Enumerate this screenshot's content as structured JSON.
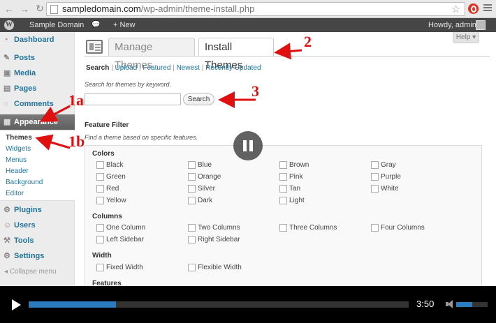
{
  "browser": {
    "url_domain": "sampledomain.com",
    "url_path": "/wp-admin/theme-install.php",
    "back_icon": "back-arrow-icon",
    "forward_icon": "forward-arrow-icon",
    "reload_icon": "reload-icon"
  },
  "adminbar": {
    "site_name": "Sample Domain",
    "new_label": "+ New",
    "greeting": "Howdy, admin"
  },
  "sidebar": {
    "items": [
      {
        "label": "Dashboard",
        "icon": "dashboard-icon"
      },
      {
        "label": "Posts",
        "icon": "pushpin-icon"
      },
      {
        "label": "Media",
        "icon": "media-icon"
      },
      {
        "label": "Pages",
        "icon": "pages-icon"
      },
      {
        "label": "Comments",
        "icon": "comments-icon"
      },
      {
        "label": "Appearance",
        "icon": "appearance-icon"
      },
      {
        "label": "Plugins",
        "icon": "plugin-icon"
      },
      {
        "label": "Users",
        "icon": "users-icon"
      },
      {
        "label": "Tools",
        "icon": "tools-icon"
      },
      {
        "label": "Settings",
        "icon": "settings-icon"
      }
    ],
    "submenu": [
      "Themes",
      "Widgets",
      "Menus",
      "Header",
      "Background",
      "Editor"
    ],
    "collapse_label": "Collapse menu"
  },
  "main": {
    "help_label": "Help ▾",
    "tabs": {
      "manage": "Manage Themes",
      "install": "Install Themes"
    },
    "subnav": [
      "Search",
      "Upload",
      "Featured",
      "Newest",
      "Recently Updated"
    ],
    "search_hint": "Search for themes by keyword.",
    "search_button": "Search",
    "feature_filter_title": "Feature Filter",
    "feature_filter_desc": "Find a theme based on specific features.",
    "groups": {
      "colors": {
        "title": "Colors",
        "options": [
          "Black",
          "Blue",
          "Brown",
          "Gray",
          "Green",
          "Orange",
          "Pink",
          "Purple",
          "Red",
          "Silver",
          "Tan",
          "White",
          "Yellow",
          "Dark",
          "Light"
        ]
      },
      "columns": {
        "title": "Columns",
        "options": [
          "One Column",
          "Two Columns",
          "Three Columns",
          "Four Columns",
          "Left Sidebar",
          "Right Sidebar"
        ]
      },
      "width": {
        "title": "Width",
        "options": [
          "Fixed Width",
          "Flexible Width"
        ]
      },
      "features": {
        "title": "Features"
      }
    }
  },
  "annotations": [
    "1a",
    "1b",
    "2",
    "3"
  ],
  "player": {
    "time": "3:50",
    "progress": 0.23,
    "volume": 0.5,
    "accent": "#2a7bbf"
  }
}
